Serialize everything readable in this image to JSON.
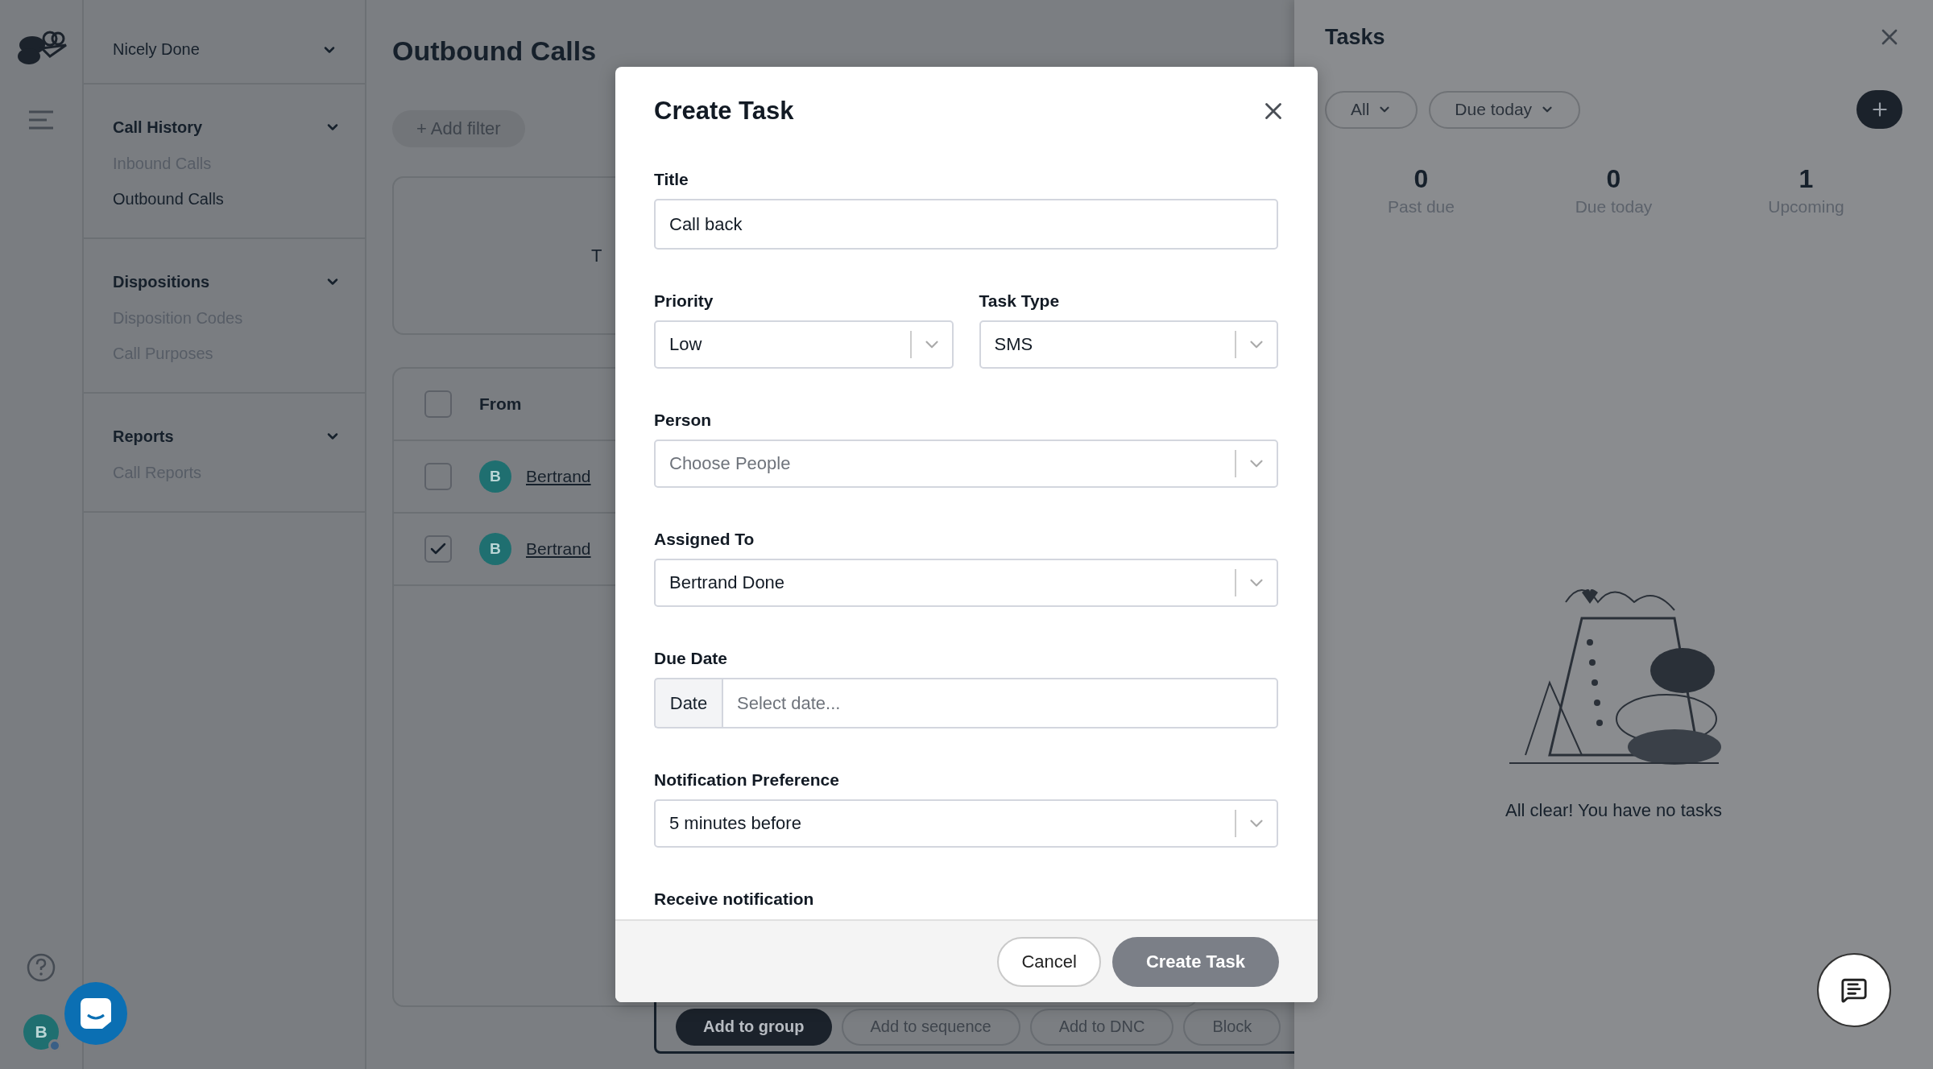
{
  "rail": {
    "avatar": "B"
  },
  "sidebar": {
    "account": "Nicely Done",
    "sections": [
      {
        "title": "Call History",
        "expanded": true,
        "items": [
          {
            "label": "Inbound Calls",
            "selected": false
          },
          {
            "label": "Outbound Calls",
            "selected": true
          }
        ]
      },
      {
        "title": "Dispositions",
        "expanded": true,
        "items": [
          {
            "label": "Disposition Codes",
            "selected": false
          },
          {
            "label": "Call Purposes",
            "selected": false
          }
        ]
      },
      {
        "title": "Reports",
        "expanded": true,
        "items": [
          {
            "label": "Call Reports",
            "selected": false
          }
        ]
      }
    ]
  },
  "main": {
    "title": "Outbound Calls",
    "add_filter": "+ Add filter",
    "card_text": "T",
    "table": {
      "columns": [
        "From"
      ],
      "select_all_checked": false,
      "rows": [
        {
          "avatar": "B",
          "from": "Bertrand",
          "checked": false
        },
        {
          "avatar": "B",
          "from": "Bertrand",
          "checked": true
        }
      ]
    },
    "bulk_actions": [
      {
        "label": "Add to group",
        "kind": "primary"
      },
      {
        "label": "Add to sequence",
        "kind": "secondary"
      },
      {
        "label": "Add to DNC",
        "kind": "secondary"
      },
      {
        "label": "Block",
        "kind": "secondary"
      }
    ]
  },
  "modal": {
    "title": "Create Task",
    "fields": [
      {
        "kind": "text",
        "label": "Title",
        "value": "Call back"
      },
      {
        "kind": "row",
        "fields": [
          {
            "kind": "select",
            "label": "Priority",
            "value": "Low"
          },
          {
            "kind": "select",
            "label": "Task Type",
            "value": "SMS"
          }
        ]
      },
      {
        "kind": "select",
        "label": "Person",
        "placeholder": "Choose People"
      },
      {
        "kind": "select",
        "label": "Assigned To",
        "value": "Bertrand Done"
      },
      {
        "kind": "date",
        "label": "Due Date",
        "addon": "Date",
        "placeholder": "Select date..."
      },
      {
        "kind": "select",
        "label": "Notification Preference",
        "value": "5 minutes before"
      },
      {
        "kind": "label",
        "label": "Receive notification"
      }
    ],
    "buttons": [
      {
        "label": "Cancel",
        "kind": "secondary"
      },
      {
        "label": "Create Task",
        "kind": "primary",
        "disabled": true
      }
    ]
  },
  "tasks": {
    "title": "Tasks",
    "filters": [
      "All",
      "Due today"
    ],
    "stats": [
      {
        "value": "0",
        "label": "Past due"
      },
      {
        "value": "0",
        "label": "Due today"
      },
      {
        "value": "1",
        "label": "Upcoming"
      }
    ],
    "empty": "All clear! You have no tasks"
  }
}
